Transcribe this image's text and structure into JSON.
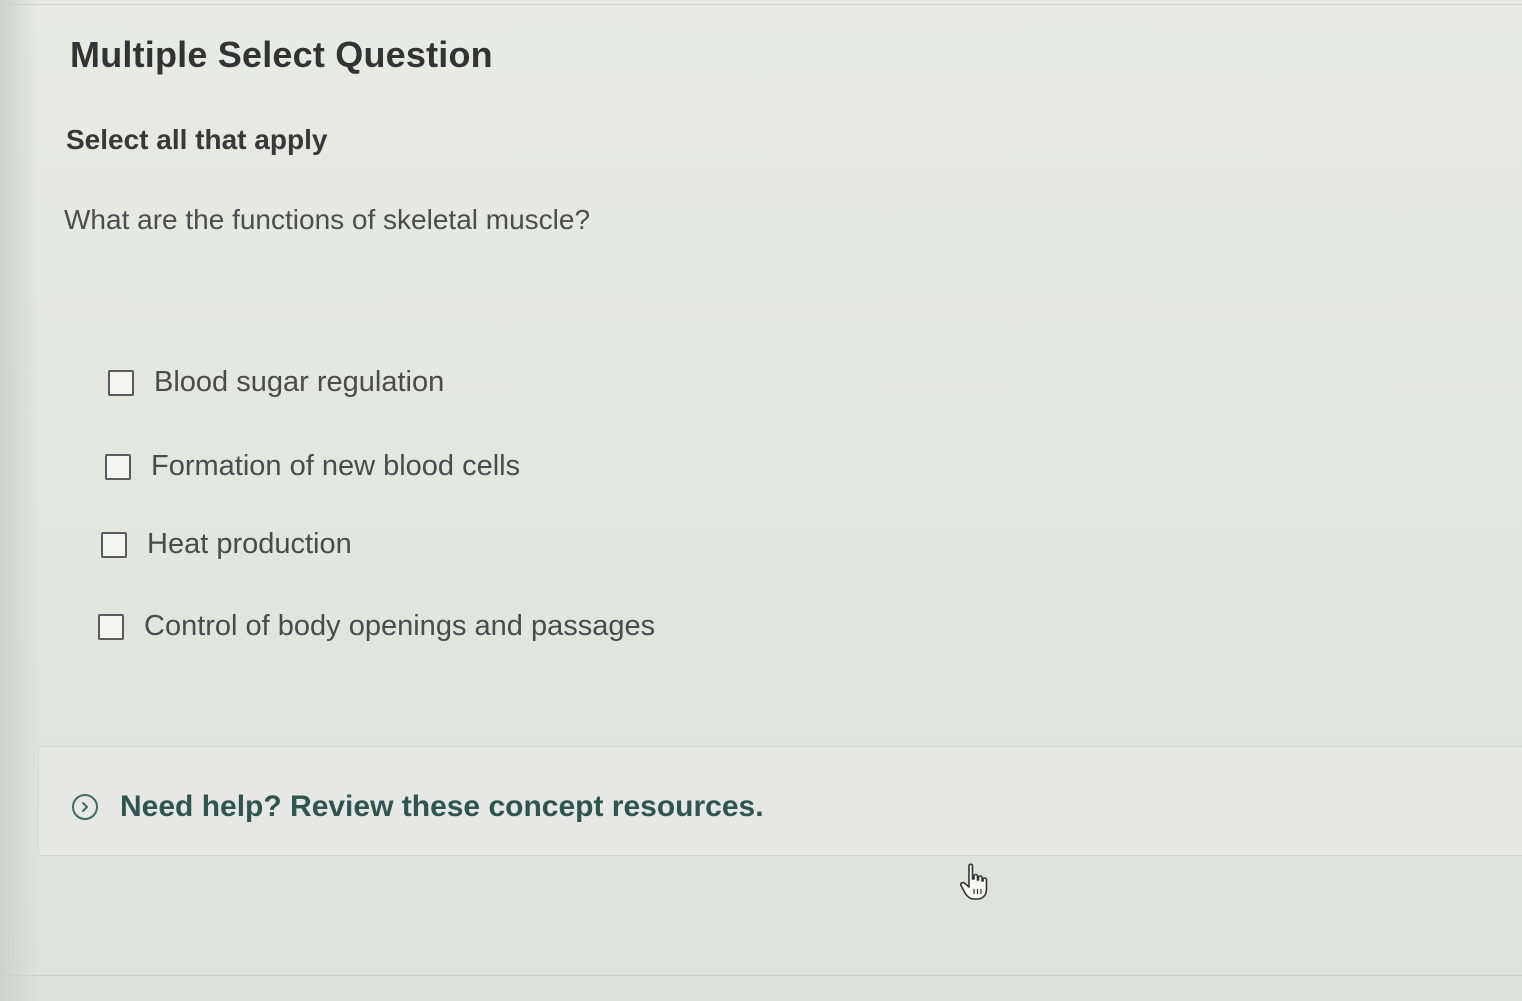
{
  "question": {
    "type_label": "Multiple Select Question",
    "instruction": "Select all that apply",
    "prompt": "What are the functions of skeletal muscle?"
  },
  "options": [
    {
      "label": "Blood sugar regulation",
      "checked": false
    },
    {
      "label": "Formation of new blood cells",
      "checked": false
    },
    {
      "label": "Heat production",
      "checked": false
    },
    {
      "label": "Control of body openings and passages",
      "checked": false
    }
  ],
  "help": {
    "text": "Need help? Review these concept resources.",
    "icon": "chevron-right-icon"
  },
  "colors": {
    "link": "#2f5550",
    "checkbox_border": "#5b5b5b",
    "text": "#4b4b4b"
  }
}
